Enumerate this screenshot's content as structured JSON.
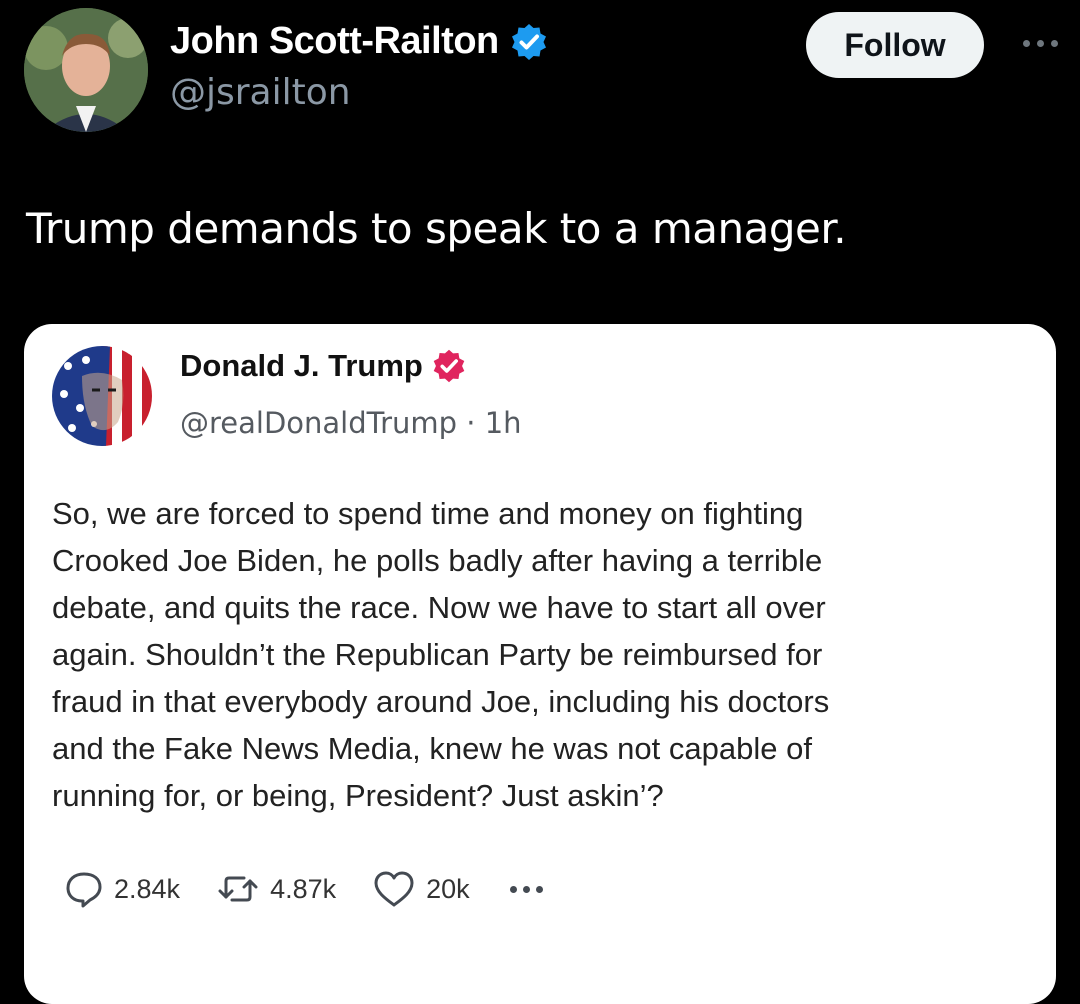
{
  "tweet": {
    "author_name": "John Scott-Railton",
    "author_handle": "@jsrailton",
    "follow_label": "Follow",
    "text": "Trump demands to speak to a manager."
  },
  "quote": {
    "author_name": "Donald J. Trump",
    "author_handle": "@realDonaldTrump",
    "separator": "·",
    "time": "1h",
    "body_lines": [
      "So, we are forced to spend time and money on fighting",
      "Crooked Joe Biden, he polls badly after having a terrible",
      "debate, and quits the race. Now we have to start all over",
      "again. Shouldn’t the Republican Party be reimbursed for",
      "fraud in that everybody around Joe, including his doctors",
      "and the Fake News Media, knew he was not capable of",
      "running for, or being, President?  Just askin’?"
    ],
    "actions": {
      "replies": "2.84k",
      "reposts": "4.87k",
      "likes": "20k"
    }
  },
  "colors": {
    "background": "#000000",
    "verified_blue": "#1d9bf0",
    "verified_pink": "#e0245e",
    "follow_bg": "#eff3f4",
    "handle_gray": "#8b98a5"
  },
  "icons": {
    "verified_badge": "verified-badge-icon",
    "more": "more-dots-icon",
    "reply": "reply-bubble-icon",
    "repost": "repost-arrows-icon",
    "like": "heart-icon"
  }
}
